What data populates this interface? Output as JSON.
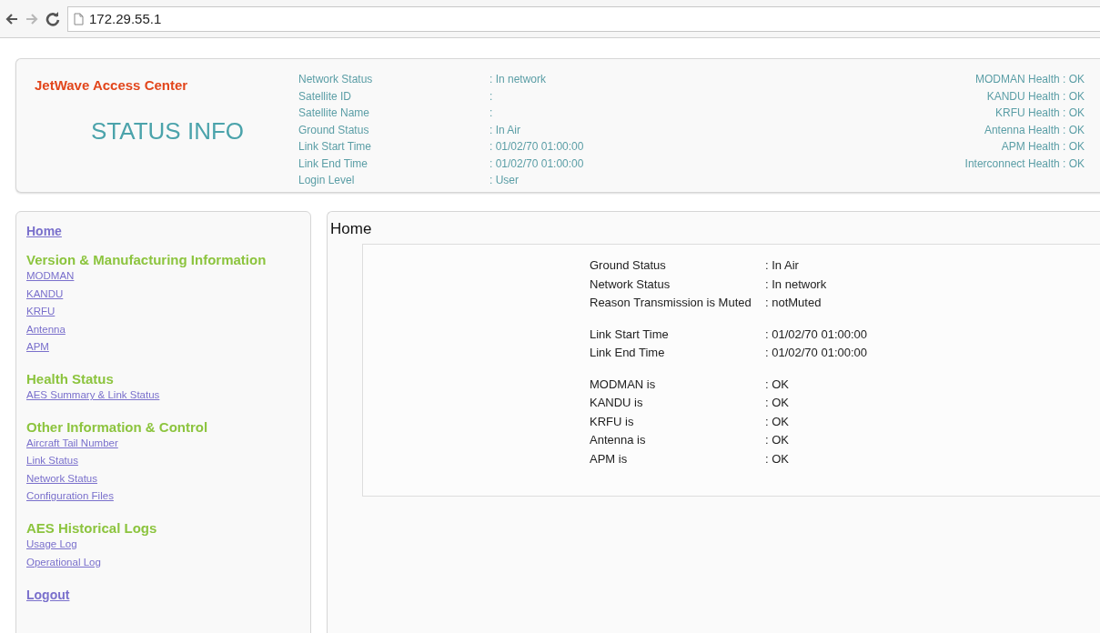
{
  "browser": {
    "back": {
      "disabled": false
    },
    "forward": {
      "disabled": true
    },
    "url": "172.29.55.1"
  },
  "header": {
    "brand": "JetWave Access Center",
    "title": "STATUS INFO",
    "fields": [
      {
        "label": "Network Status",
        "value": ": In network"
      },
      {
        "label": "Satellite ID",
        "value": ":"
      },
      {
        "label": "Satellite Name",
        "value": ":"
      },
      {
        "label": "Ground Status",
        "value": ": In Air"
      },
      {
        "label": "Link Start Time",
        "value": ": 01/02/70 01:00:00"
      },
      {
        "label": "Link End Time",
        "value": ": 01/02/70 01:00:00"
      },
      {
        "label": "Login Level",
        "value": ": User"
      }
    ],
    "health": [
      "MODMAN Health : OK",
      "KANDU Health : OK",
      "KRFU Health : OK",
      "Antenna Health : OK",
      "APM Health : OK",
      "Interconnect Health : OK"
    ]
  },
  "sidebar": {
    "items": [
      {
        "kind": "link",
        "label": "Home"
      },
      {
        "kind": "section",
        "heading": "Version & Manufacturing Information",
        "links": [
          "MODMAN",
          "KANDU",
          "KRFU",
          "Antenna",
          "APM"
        ]
      },
      {
        "kind": "section",
        "heading": "Health Status",
        "links": [
          "AES Summary & Link Status"
        ]
      },
      {
        "kind": "section",
        "heading": "Other Information & Control",
        "links": [
          "Aircraft Tail Number",
          "Link Status",
          "Network Status",
          "Configuration Files"
        ]
      },
      {
        "kind": "section",
        "heading": "AES Historical Logs",
        "links": [
          "Usage Log",
          "Operational Log"
        ]
      },
      {
        "kind": "link",
        "label": "Logout"
      }
    ]
  },
  "main": {
    "title": "Home",
    "groups": [
      [
        {
          "label": "Ground Status",
          "value": ": In Air"
        },
        {
          "label": "Network Status",
          "value": ": In network"
        },
        {
          "label": "Reason Transmission is Muted",
          "value": ": notMuted"
        }
      ],
      [
        {
          "label": "Link Start Time",
          "value": ": 01/02/70 01:00:00"
        },
        {
          "label": "Link End Time",
          "value": ": 01/02/70 01:00:00"
        }
      ],
      [
        {
          "label": "MODMAN is",
          "value": ": OK"
        },
        {
          "label": "KANDU is",
          "value": ": OK"
        },
        {
          "label": "KRFU is",
          "value": ": OK"
        },
        {
          "label": "Antenna is",
          "value": ": OK"
        },
        {
          "label": "APM is",
          "value": ": OK"
        }
      ]
    ]
  }
}
